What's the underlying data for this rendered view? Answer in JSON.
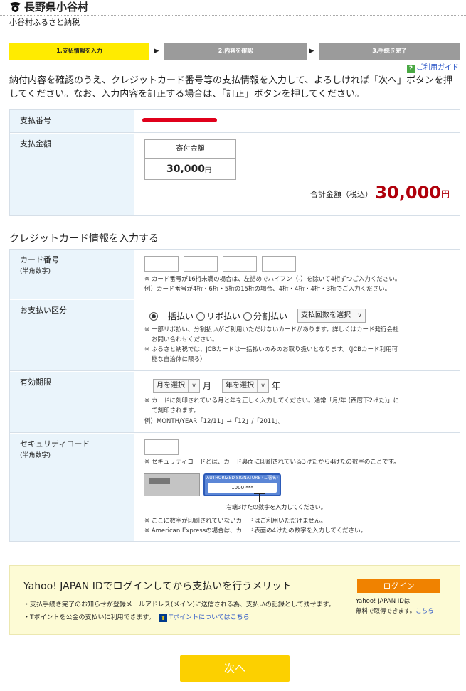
{
  "header": {
    "village": "長野県小谷村",
    "subtitle": "小谷村ふるさと納税"
  },
  "steps": [
    {
      "label": "1.支払情報を入力",
      "active": true
    },
    {
      "label": "2.内容を確認",
      "active": false
    },
    {
      "label": "3.手続き完了",
      "active": false
    }
  ],
  "guide_link": "ご利用ガイド",
  "intro_text": "納付内容を確認のうえ、クレジットカード番号等の支払情報を入力して、よろしければ「次へ」ボタンを押してください。なお、入力内容を訂正する場合は、「訂正」ボタンを押してください。",
  "payment": {
    "number_label": "支払番号",
    "amount_label": "支払金額",
    "box_header": "寄付金額",
    "box_value": "30,000",
    "yen": "円",
    "total_label": "合計金額（税込）",
    "total_value": "30,000"
  },
  "card_section_title": "クレジットカード情報を入力する",
  "card_number": {
    "label": "カード番号",
    "sub": "(半角数字)",
    "note1": "※ カード番号が16桁未満の場合は、左詰めでハイフン（-）を除いて4桁ずつご入力ください。",
    "note2": "例）カード番号が4桁・6桁・5桁の15桁の場合、4桁・4桁・4桁・3桁でご入力ください。"
  },
  "payment_type": {
    "label": "お支払い区分",
    "opt_lump": "一括払い",
    "opt_revo": "リボ払い",
    "opt_split": "分割払い",
    "select_count": "支払回数を選択",
    "note1": "※ 一部リボ払い、分割払いがご利用いただけないカードがあります。詳しくはカード発行会社",
    "note1b": "お問い合わせください。",
    "note2": "※ ふるさと納税では、JCBカードは一括払いのみのお取り扱いとなります。（JCBカード利用可",
    "note2b": "能な自治体に限る）"
  },
  "expiry": {
    "label": "有効期限",
    "month_select": "月を選択",
    "month_unit": "月",
    "year_select": "年を選択",
    "year_unit": "年",
    "note1": "※ カードに刻印されている月と年を正しく入力してください。通常「月/年 (西暦下2けた)」に",
    "note1b": "て刻印されます。",
    "note2": "例）MONTH/YEAR「12/11」→「12」/「2011」。"
  },
  "security": {
    "label": "セキュリティコード",
    "sub": "(半角数字)",
    "note1": "※ セキュリティコードとは、カード裏面に印刷されている3けたから4けたの数字のことです。",
    "sig_header": "AUTHORIZED SIGNATURE (ご署名)",
    "sig_value": "1000 ***",
    "caption": "右端3けたの数字を入力してください。",
    "note2": "※ ここに数字が印刷されていないカードはご利用いただけません。",
    "note3": "※ American Expressの場合は、カード表面の4けたの数字を入力してください。"
  },
  "yahoo": {
    "title": "Yahoo! JAPAN IDでログインしてから支払いを行うメリット",
    "benefit1": "・支払手続き完了のお知らせが登録メールアドレス(メイン)に送信される為、支払いの記録として残せます。",
    "benefit2": "・Tポイントを公金の支払いに利用できます。",
    "tpoint_icon_text": "T",
    "tpoint_link": "Tポイントについてはこちら",
    "login_button": "ログイン",
    "side1": "Yahoo! JAPAN IDは",
    "side2": "無料で取得できます。",
    "side_link": "こちら"
  },
  "next_button": "次へ"
}
